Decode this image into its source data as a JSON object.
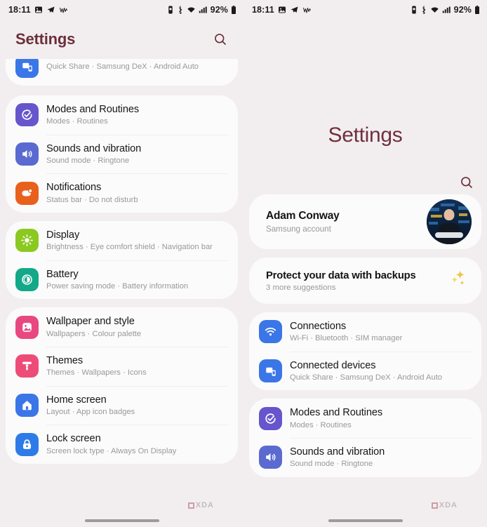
{
  "status_bar": {
    "time": "18:11",
    "left_icons": [
      "photo-icon",
      "telegram-icon",
      "waveform-icon"
    ],
    "right_icons": [
      "vibrate-icon",
      "bluetooth-icon",
      "wifi-icon",
      "signal-icon"
    ],
    "battery_percent": "92%"
  },
  "left_phone": {
    "header_title": "Settings",
    "search_icon": "search-icon",
    "partial_card": {
      "icon": "connected-devices-icon",
      "icon_color": "#3b76e8",
      "subtitle": "Quick Share  ·  Samsung DeX  ·  Android Auto"
    },
    "groups": [
      {
        "items": [
          {
            "title": "Modes and Routines",
            "subtitle": "Modes  ·  Routines",
            "icon": "modes-icon",
            "icon_color": "#6655cc"
          },
          {
            "title": "Sounds and vibration",
            "subtitle": "Sound mode  ·  Ringtone",
            "icon": "sound-icon",
            "icon_color": "#5a6ad0"
          },
          {
            "title": "Notifications",
            "subtitle": "Status bar  ·  Do not disturb",
            "icon": "notifications-icon",
            "icon_color": "#e8601c"
          }
        ]
      },
      {
        "items": [
          {
            "title": "Display",
            "subtitle": "Brightness  ·  Eye comfort shield  ·  Navigation bar",
            "icon": "display-icon",
            "icon_color": "#8bc921"
          },
          {
            "title": "Battery",
            "subtitle": "Power saving mode  ·  Battery information",
            "icon": "battery-icon",
            "icon_color": "#13a888"
          }
        ]
      },
      {
        "items": [
          {
            "title": "Wallpaper and style",
            "subtitle": "Wallpapers  ·  Colour palette",
            "icon": "wallpaper-icon",
            "icon_color": "#e8487f"
          },
          {
            "title": "Themes",
            "subtitle": "Themes  ·  Wallpapers  ·  Icons",
            "icon": "themes-icon",
            "icon_color": "#ee4c78"
          },
          {
            "title": "Home screen",
            "subtitle": "Layout  ·  App icon badges",
            "icon": "home-screen-icon",
            "icon_color": "#3b76e8"
          },
          {
            "title": "Lock screen",
            "subtitle": "Screen lock type  ·  Always On Display",
            "icon": "lock-screen-icon",
            "icon_color": "#2e7be8"
          }
        ]
      }
    ]
  },
  "right_phone": {
    "header_title": "Settings",
    "search_icon": "search-icon",
    "account": {
      "name": "Adam Conway",
      "subtitle": "Samsung account",
      "avatar": "user-avatar"
    },
    "suggestion": {
      "title": "Protect your data with backups",
      "subtitle": "3 more suggestions",
      "icon": "sparkles-icon"
    },
    "groups": [
      {
        "items": [
          {
            "title": "Connections",
            "subtitle": "Wi-Fi  ·  Bluetooth  ·  SIM manager",
            "icon": "connections-icon",
            "icon_color": "#3b76e8"
          },
          {
            "title": "Connected devices",
            "subtitle": "Quick Share  ·  Samsung DeX  ·  Android Auto",
            "icon": "connected-devices-icon",
            "icon_color": "#3b76e8"
          }
        ]
      },
      {
        "items": [
          {
            "title": "Modes and Routines",
            "subtitle": "Modes  ·  Routines",
            "icon": "modes-icon",
            "icon_color": "#6655cc"
          },
          {
            "title": "Sounds and vibration",
            "subtitle": "Sound mode  ·  Ringtone",
            "icon": "sound-icon",
            "icon_color": "#5a6ad0"
          }
        ]
      }
    ]
  },
  "watermark": {
    "text": "XDA"
  },
  "colors": {
    "background": "#f2eeef",
    "card": "#fcfbfb",
    "title_accent": "#6d2f3d",
    "primary_text": "#161616",
    "secondary_text": "#9a9798"
  }
}
